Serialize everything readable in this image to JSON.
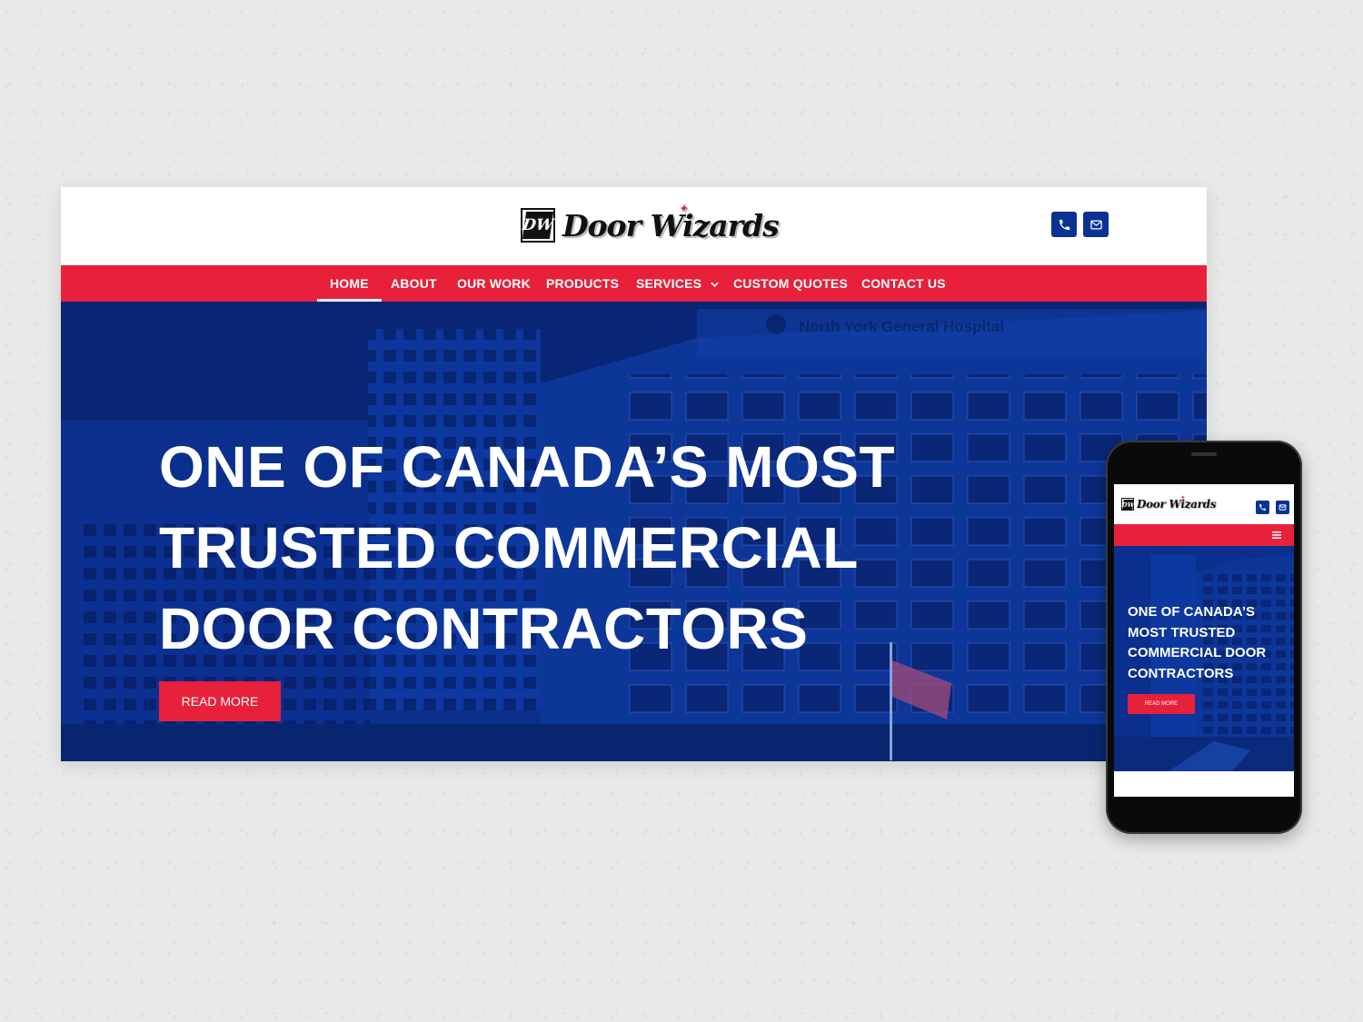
{
  "desktop": {
    "logo": {
      "mark": "DW",
      "text": "Door Wizards"
    },
    "nav": {
      "items": [
        {
          "label": "HOME",
          "active": true
        },
        {
          "label": "ABOUT"
        },
        {
          "label": "OUR WORK"
        },
        {
          "label": "PRODUCTS"
        },
        {
          "label": "SERVICES",
          "has_dropdown": true
        },
        {
          "label": "CUSTOM QUOTES"
        },
        {
          "label": "CONTACT US"
        }
      ]
    },
    "hero": {
      "title": "ONE OF CANADA’S MOST TRUSTED COMMERCIAL DOOR CONTRACTORS",
      "button_label": "READ MORE",
      "building_sign": "North York General Hospital"
    },
    "header_icons": [
      "phone-icon",
      "mail-icon"
    ]
  },
  "mobile": {
    "logo": {
      "mark": "DW",
      "text": "Door Wizards"
    },
    "hero": {
      "title": "ONE OF CANADA’S MOST TRUSTED COMMERCIAL DOOR CONTRACTORS",
      "button_label": "READ MORE"
    },
    "header_icons": [
      "phone-icon",
      "mail-icon"
    ],
    "menu_icon": "hamburger-icon"
  },
  "colors": {
    "accent_red": "#e8203a",
    "brand_blue": "#0a3295",
    "hero_overlay": "#0b3397",
    "background": "#e9e9e8"
  }
}
